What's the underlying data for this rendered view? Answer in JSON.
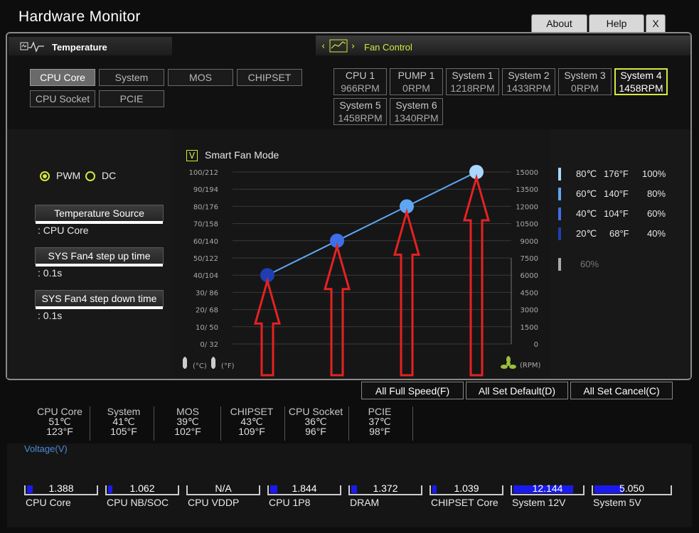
{
  "app": {
    "title": "Hardware Monitor"
  },
  "header_buttons": {
    "about": "About",
    "help": "Help",
    "close": "X"
  },
  "temperature_tab": {
    "label": "Temperature"
  },
  "fan_tab": {
    "label": "Fan Control"
  },
  "temp_sources": [
    {
      "label": "CPU Core",
      "active": true
    },
    {
      "label": "System",
      "active": false
    },
    {
      "label": "MOS",
      "active": false
    },
    {
      "label": "CHIPSET",
      "active": false
    },
    {
      "label": "CPU Socket",
      "active": false
    },
    {
      "label": "PCIE",
      "active": false
    }
  ],
  "fans": [
    {
      "name": "CPU 1",
      "rpm": "966RPM"
    },
    {
      "name": "PUMP 1",
      "rpm": "0RPM"
    },
    {
      "name": "System 1",
      "rpm": "1218RPM"
    },
    {
      "name": "System 2",
      "rpm": "1433RPM"
    },
    {
      "name": "System 3",
      "rpm": "0RPM"
    },
    {
      "name": "System 4",
      "rpm": "1458RPM",
      "active": true
    },
    {
      "name": "System 5",
      "rpm": "1458RPM"
    },
    {
      "name": "System 6",
      "rpm": "1340RPM"
    }
  ],
  "mode": {
    "pwm": "PWM",
    "dc": "DC",
    "selected": "PWM"
  },
  "settings": {
    "temp_source_label": "Temperature Source",
    "temp_source_value": ": CPU Core",
    "step_up_label": "SYS Fan4 step up time",
    "step_up_value": ": 0.1s",
    "step_down_label": "SYS Fan4 step down time",
    "step_down_value": ": 0.1s"
  },
  "smart_fan": {
    "checkbox_mark": "V",
    "label": "Smart Fan Mode",
    "checked": true
  },
  "chart_data": {
    "type": "line",
    "y_left_ticks": [
      "100/212",
      "90/194",
      "80/176",
      "70/158",
      "60/140",
      "50/122",
      "40/104",
      "30/ 86",
      "20/ 68",
      "10/ 50",
      "0/ 32"
    ],
    "y_right_ticks": [
      "15000",
      "13500",
      "12000",
      "10500",
      "9000",
      "7500",
      "6000",
      "4500",
      "3000",
      "1500",
      "0"
    ],
    "x_unit_c": "(°C)",
    "x_unit_f": "(°F)",
    "rpm_unit": "(RPM)",
    "points": [
      {
        "temp_c": 40,
        "percent": 40,
        "color": "#1f3fb0"
      },
      {
        "temp_c": 60,
        "percent": 60,
        "color": "#3f6fe6"
      },
      {
        "temp_c": 80,
        "percent": 80,
        "color": "#5fa6f2"
      },
      {
        "temp_c": 100,
        "percent": 100,
        "color": "#a8d8ff"
      }
    ],
    "annotation": "red arrows pointing up at each control point"
  },
  "legend": [
    {
      "c": "80℃",
      "f": "176°F",
      "pct": "100%",
      "color": "#a8d8ff"
    },
    {
      "c": "60℃",
      "f": "140°F",
      "pct": "80%",
      "color": "#5fa6f2"
    },
    {
      "c": "40℃",
      "f": "104°F",
      "pct": "60%",
      "color": "#3f6fe6"
    },
    {
      "c": "20℃",
      "f": "68°F",
      "pct": "40%",
      "color": "#1f3fb0"
    }
  ],
  "legend_extra": {
    "pct": "60%",
    "color": "#aaaaaa"
  },
  "actions": {
    "full_speed": "All Full Speed(F)",
    "set_default": "All Set Default(D)",
    "set_cancel": "All Set Cancel(C)"
  },
  "temp_stats": [
    {
      "name": "CPU Core",
      "c": "51℃",
      "f": "123°F"
    },
    {
      "name": "System",
      "c": "41℃",
      "f": "105°F"
    },
    {
      "name": "MOS",
      "c": "39℃",
      "f": "102°F"
    },
    {
      "name": "CHIPSET",
      "c": "43℃",
      "f": "109°F"
    },
    {
      "name": "CPU Socket",
      "c": "36℃",
      "f": "96°F"
    },
    {
      "name": "PCIE",
      "c": "37℃",
      "f": "98°F"
    }
  ],
  "voltage": {
    "title": "Voltage(V)",
    "items": [
      {
        "name": "CPU Core",
        "value": "1.388",
        "fill": 0.08
      },
      {
        "name": "CPU NB/SOC",
        "value": "1.062",
        "fill": 0.06
      },
      {
        "name": "CPU VDDP",
        "value": "N/A",
        "fill": 0
      },
      {
        "name": "CPU 1P8",
        "value": "1.844",
        "fill": 0.1
      },
      {
        "name": "DRAM",
        "value": "1.372",
        "fill": 0.08
      },
      {
        "name": "CHIPSET Core",
        "value": "1.039",
        "fill": 0.06
      },
      {
        "name": "System 12V",
        "value": "12.144",
        "fill": 0.88
      },
      {
        "name": "System 5V",
        "value": "5.050",
        "fill": 0.38
      }
    ]
  }
}
